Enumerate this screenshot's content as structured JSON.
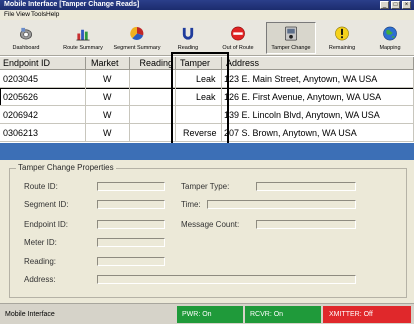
{
  "window": {
    "title": "Mobile Interface  [Tamper Change Reads]",
    "controls": [
      "_",
      "□",
      "×"
    ]
  },
  "menu": [
    "File",
    "View",
    "Tools",
    "Help"
  ],
  "toolbar": [
    {
      "label": "Dashboard",
      "icon": "dashboard-icon"
    },
    {
      "label": "Route Summary",
      "icon": "route-summary-icon"
    },
    {
      "label": "Segment Summary",
      "icon": "segment-summary-icon"
    },
    {
      "label": "Reading",
      "icon": "reading-icon"
    },
    {
      "label": "Out of Route",
      "icon": "out-of-route-icon"
    },
    {
      "label": "Tamper Change",
      "icon": "tamper-change-icon",
      "active": true
    },
    {
      "label": "Remaining",
      "icon": "remaining-icon"
    },
    {
      "label": "Mapping",
      "icon": "mapping-icon"
    }
  ],
  "table": {
    "columns": [
      "Endpoint ID",
      "Market",
      "Reading",
      "Tamper",
      "Address"
    ],
    "rows": [
      {
        "endpoint": "0203045",
        "market": "W",
        "reading": "",
        "tamper": "Leak",
        "address": "123 E. Main Street, Anytown, WA USA"
      },
      {
        "endpoint": "0205626",
        "market": "W",
        "reading": "",
        "tamper": "Leak",
        "address": "126 E. First Avenue, Anytown, WA USA",
        "selected": true
      },
      {
        "endpoint": "0206942",
        "market": "W",
        "reading": "",
        "tamper": "",
        "address": "139 E. Lincoln Blvd, Anytown, WA USA"
      },
      {
        "endpoint": "0306213",
        "market": "W",
        "reading": "",
        "tamper": "Reverse",
        "address": "207 S. Brown, Anytown, WA USA"
      }
    ]
  },
  "properties": {
    "title": "Tamper Change Properties",
    "route_label": "Route ID:",
    "segment_label": "Segment ID:",
    "endpoint_label": "Endpoint ID:",
    "meter_label": "Meter ID:",
    "reading_label": "Reading:",
    "address_label": "Address:",
    "tamper_type_label": "Tamper Type:",
    "time_label": "Time:",
    "message_count_label": "Message Count:"
  },
  "status": {
    "app": "Mobile Interface",
    "pwr": "PWR: On",
    "rcvr": "RCVR: On",
    "xmitter": "XMITTER: Off",
    "colors": {
      "on": "#1f9a3a",
      "off": "#e0282b"
    }
  }
}
